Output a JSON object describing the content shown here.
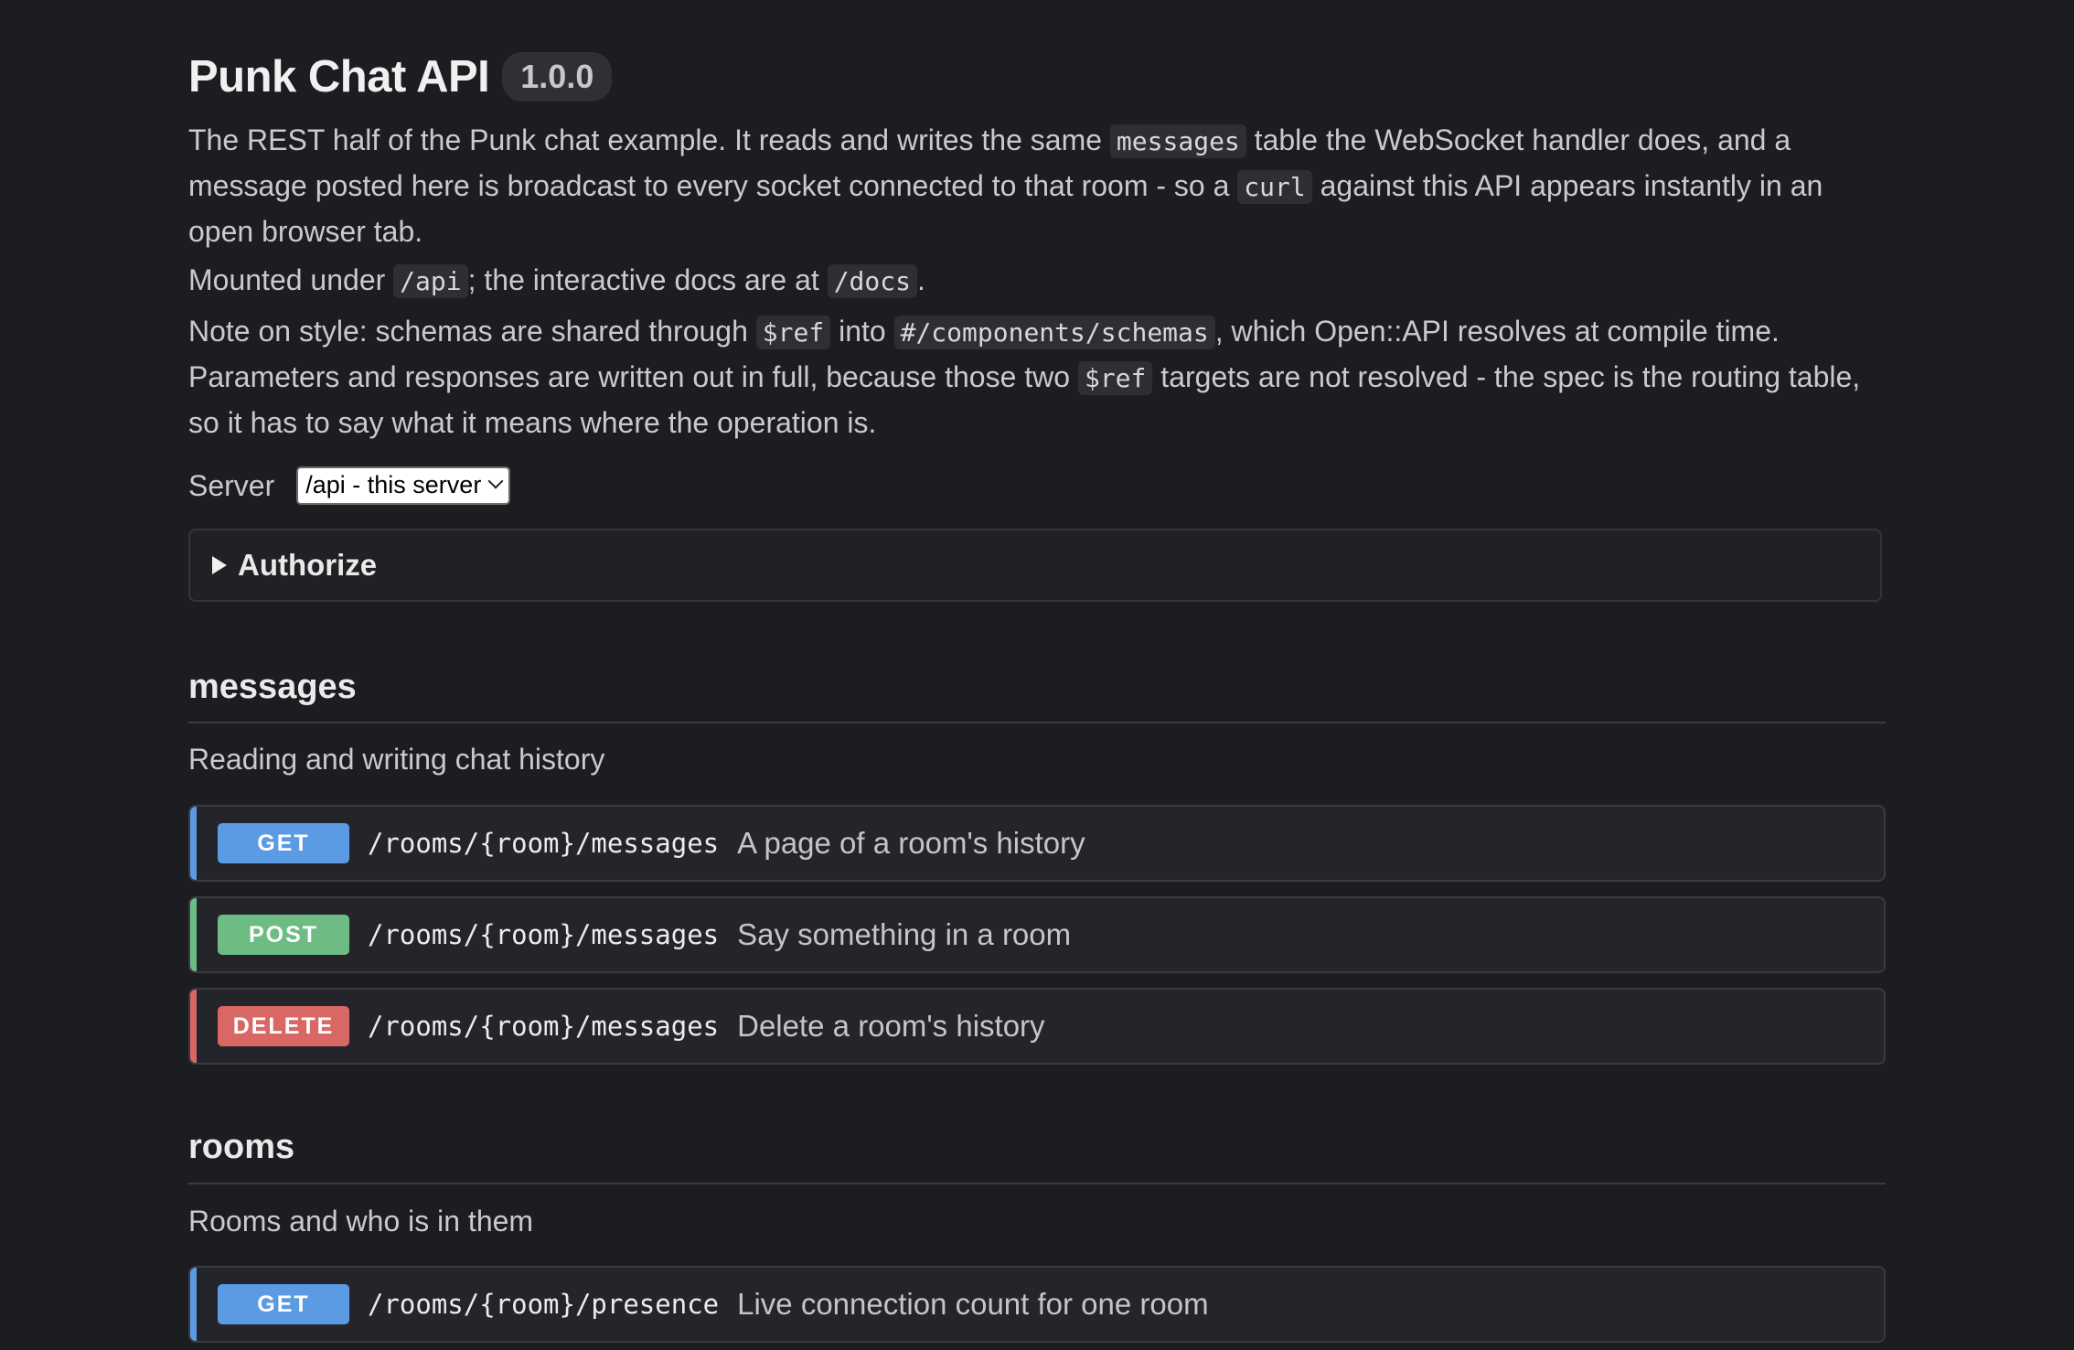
{
  "header": {
    "title": "Punk Chat API",
    "version": "1.0.0"
  },
  "description": {
    "p1": {
      "t1": "The REST half of the Punk chat example. It reads and writes the same ",
      "c1": "messages",
      "t2": " table the WebSocket handler does, and a message posted here is broadcast to every socket connected to that room - so a ",
      "c2": "curl",
      "t3": " against this API appears instantly in an open browser tab."
    },
    "p2": {
      "t1": "Mounted under ",
      "c1": "/api",
      "t2": "; the interactive docs are at ",
      "c2": "/docs",
      "t3": "."
    },
    "p3": {
      "t1": "Note on style: schemas are shared through ",
      "c1": "$ref",
      "t2": " into ",
      "c2": "#/components/schemas",
      "t3": ", which Open::API resolves at compile time. Parameters and responses are written out in full, because those two ",
      "c3": "$ref",
      "t4": " targets are not resolved - the spec is the routing table, so it has to say what it means where the operation is."
    }
  },
  "server": {
    "label": "Server",
    "selected": "/api - this server"
  },
  "authorize": {
    "label": "Authorize"
  },
  "colors": {
    "get": "#5a9be3",
    "post": "#6cbc84",
    "delete": "#d96865"
  },
  "sections": [
    {
      "name": "messages",
      "description": "Reading and writing chat history",
      "operations": [
        {
          "method": "GET",
          "path": "/rooms/{room}/messages",
          "summary": "A page of a room's history"
        },
        {
          "method": "POST",
          "path": "/rooms/{room}/messages",
          "summary": "Say something in a room"
        },
        {
          "method": "DELETE",
          "path": "/rooms/{room}/messages",
          "summary": "Delete a room's history"
        }
      ]
    },
    {
      "name": "rooms",
      "description": "Rooms and who is in them",
      "operations": [
        {
          "method": "GET",
          "path": "/rooms/{room}/presence",
          "summary": "Live connection count for one room"
        }
      ]
    }
  ]
}
